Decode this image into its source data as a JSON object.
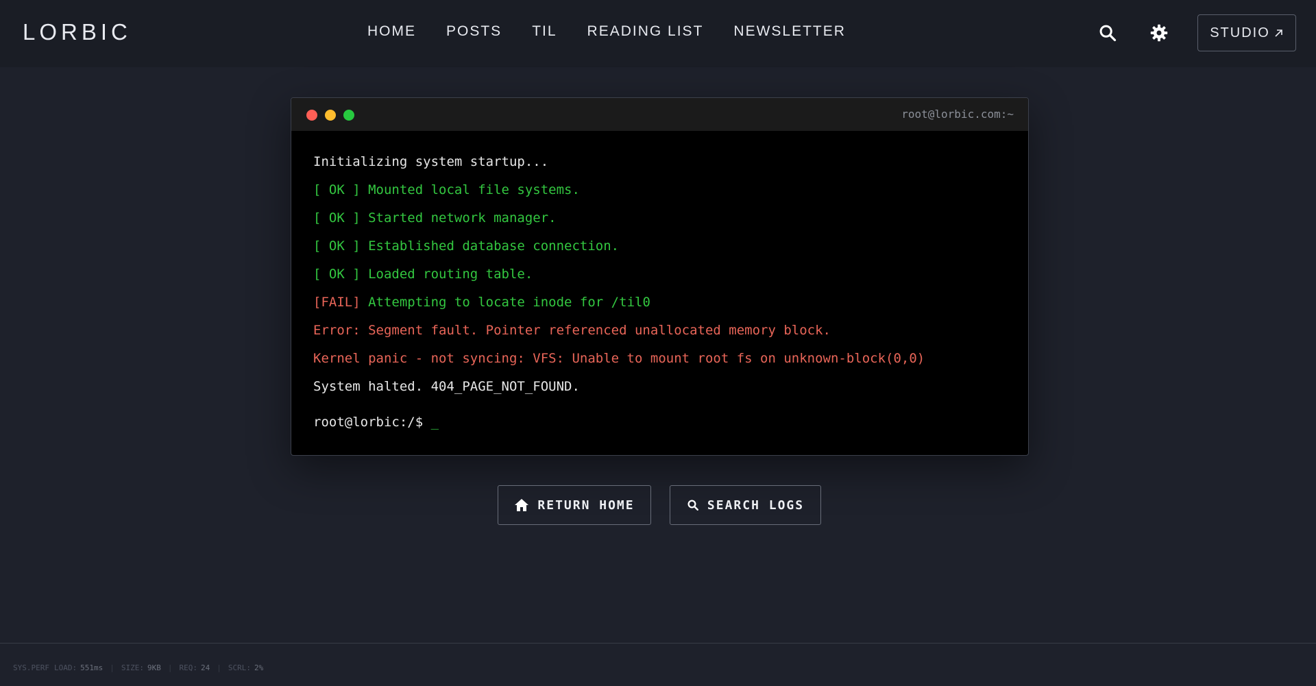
{
  "header": {
    "logo": "LORBIC",
    "nav": [
      {
        "label": "HOME"
      },
      {
        "label": "POSTS"
      },
      {
        "label": "TIL"
      },
      {
        "label": "READING LIST"
      },
      {
        "label": "NEWSLETTER"
      }
    ],
    "studio_label": "STUDIO",
    "studio_icon": "arrow-up-right-icon"
  },
  "terminal": {
    "title": "root@lorbic.com:~",
    "dots": [
      "#ff5f56",
      "#ffbd2e",
      "#27c93f"
    ],
    "lines": [
      {
        "prefix": "",
        "text": "Initializing system startup...",
        "color": "white"
      },
      {
        "prefix": "[ OK ] ",
        "text": "Mounted local file systems.",
        "color": "green"
      },
      {
        "prefix": "[ OK ] ",
        "text": "Started network manager.",
        "color": "green"
      },
      {
        "prefix": "[ OK ] ",
        "text": "Established database connection.",
        "color": "green"
      },
      {
        "prefix": "[ OK ] ",
        "text": "Loaded routing table.",
        "color": "green"
      },
      {
        "prefix": "[FAIL] ",
        "text": "Attempting to locate inode for /til0",
        "color": "fail"
      },
      {
        "prefix": "",
        "text": "Error: Segment fault. Pointer referenced unallocated memory block.",
        "color": "red"
      },
      {
        "prefix": "",
        "text": "Kernel panic - not syncing: VFS: Unable to mount root fs on unknown-block(0,0)",
        "color": "red"
      },
      {
        "prefix": "",
        "text": "System halted. 404_PAGE_NOT_FOUND.",
        "color": "white"
      }
    ],
    "prompt": "root@lorbic:/$ ",
    "cursor": "_"
  },
  "actions": {
    "return_home": "RETURN HOME",
    "search_logs": "SEARCH LOGS"
  },
  "footer": {
    "sys_perf": "SYS.PERF",
    "load_label": "LOAD:",
    "load_value": "551ms",
    "size_label": "SIZE:",
    "size_value": "9KB",
    "req_label": "REQ:",
    "req_value": "24",
    "scrl_label": "SCRL:",
    "scrl_value": "2%"
  },
  "colors": {
    "background": "#1e212b",
    "ok_green": "#33c740",
    "error_red": "#e86558"
  }
}
